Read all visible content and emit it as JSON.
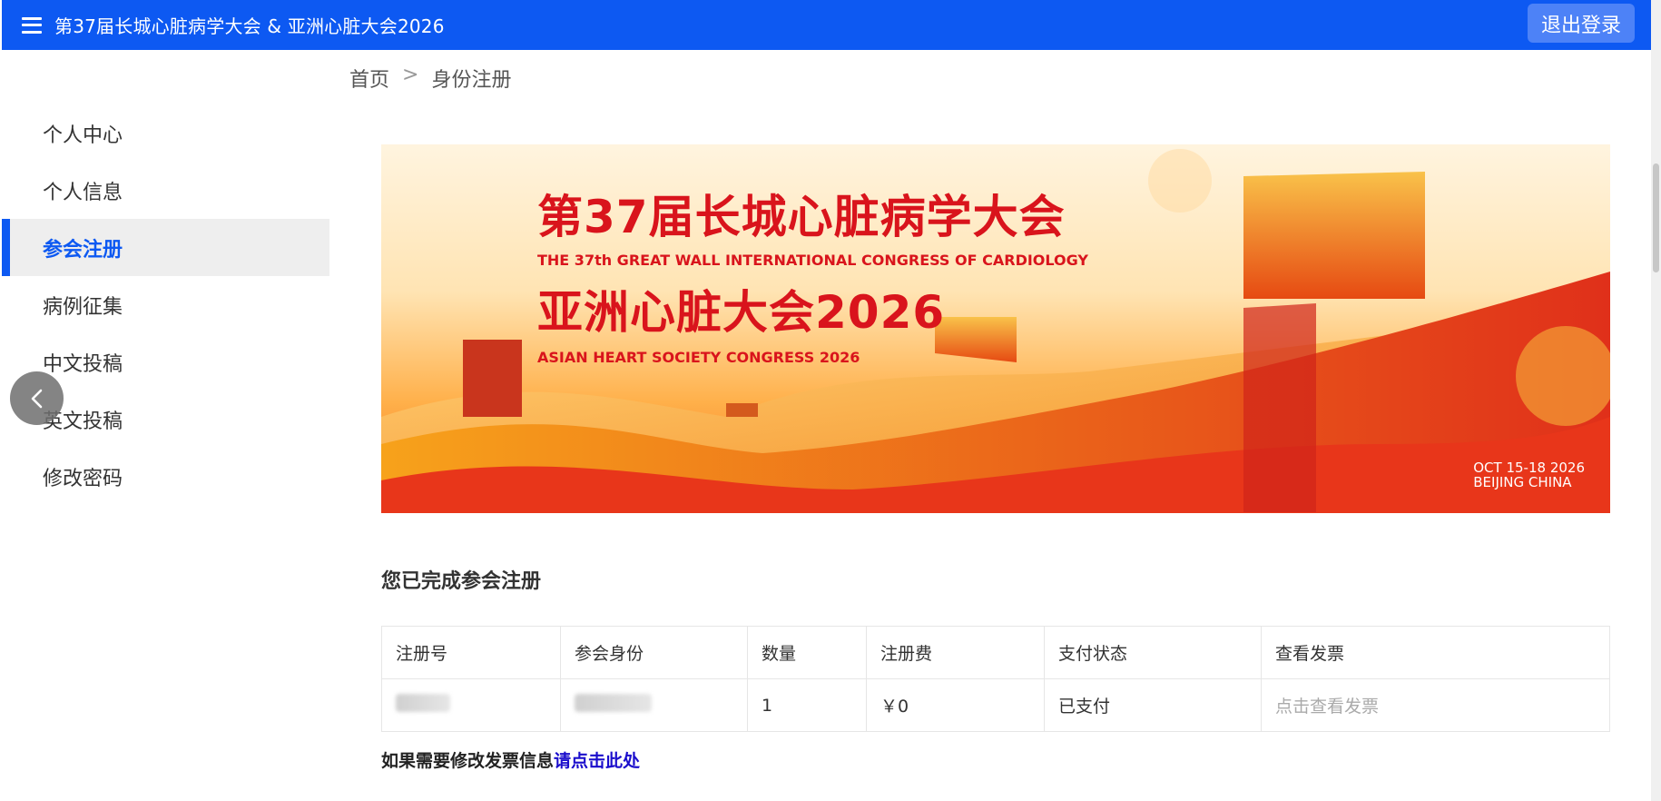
{
  "header": {
    "title": "第37届长城心脏病学大会 & 亚洲心脏大会2026",
    "logout_label": "退出登录",
    "menu_icon": "hamburger-menu-icon",
    "color": "#0d59f2"
  },
  "sidebar": {
    "items": [
      {
        "label": "个人中心",
        "active": false
      },
      {
        "label": "个人信息",
        "active": false
      },
      {
        "label": "参会注册",
        "active": true
      },
      {
        "label": "病例征集",
        "active": false
      },
      {
        "label": "中文投稿",
        "active": false
      },
      {
        "label": "英文投稿",
        "active": false
      },
      {
        "label": "修改密码",
        "active": false
      }
    ],
    "collapse_icon": "chevron-left-icon"
  },
  "breadcrumb": {
    "home": "首页",
    "separator": ">",
    "current": "身份注册"
  },
  "banner": {
    "title_cn": "第37届长城心脏病学大会",
    "title_en": "THE 37th GREAT WALL INTERNATIONAL CONGRESS OF CARDIOLOGY",
    "subtitle_cn": "亚洲心脏大会2026",
    "subtitle_en": "ASIAN HEART SOCIETY CONGRESS 2026",
    "date": "OCT 15-18 2026",
    "location": "BEIJING CHINA",
    "title_color": "#d9141c"
  },
  "registration": {
    "heading": "您已完成参会注册",
    "columns": [
      "注册号",
      "参会身份",
      "数量",
      "注册费",
      "支付状态",
      "查看发票"
    ],
    "row": {
      "quantity": "1",
      "fee": "￥0",
      "payment_status": "已支付",
      "invoice_link": "点击查看发票"
    },
    "invoice_note": "如果需要修改发票信息",
    "invoice_link": "请点击此处"
  }
}
